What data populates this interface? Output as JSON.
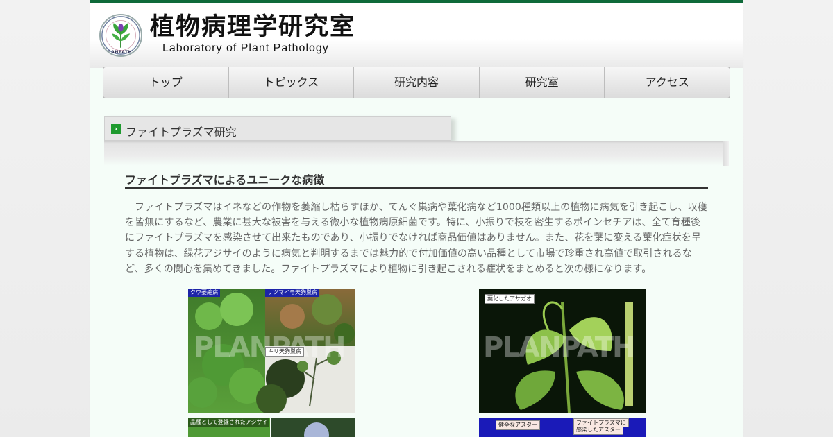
{
  "site": {
    "title": "植物病理学研究室",
    "subtitle": "Laboratory of Plant Pathology",
    "logo_text": "PLANPATH"
  },
  "nav": {
    "items": [
      {
        "label": "トップ"
      },
      {
        "label": "トピックス"
      },
      {
        "label": "研究内容"
      },
      {
        "label": "研究室"
      },
      {
        "label": "アクセス"
      }
    ]
  },
  "section": {
    "heading": "ファイトプラズマ研究",
    "icon": "chevron-right-icon"
  },
  "article": {
    "title": "ファイトプラズマによるユニークな病徴",
    "body": "ファイトプラズマはイネなどの作物を萎縮し枯らすほか、てんぐ巣病や葉化病など1000種類以上の植物に病気を引き起こし、収穫を皆無にするなど、農業に甚大な被害を与える微小な植物病原細菌です。特に、小振りで枝を密生するポインセチアは、全て育種後にファイトプラズマを感染させて出来たものであり、小振りでなければ商品価値はありません。また、花を葉に変える葉化症状を呈する植物は、緑花アジサイのように病気と判明するまでは魅力的で付加価値の高い品種として市場で珍重され高値で取引されるなど、多くの関心を集めてきました。ファイトプラズマにより植物に引き起こされる症状をまとめると次の様になります。"
  },
  "photos": {
    "left_top": {
      "label_1": "クワ萎縮病",
      "label_2": "サツマイモ天狗巣病",
      "label_3": "キリ天狗巣病",
      "watermark": "PLANPATH"
    },
    "left_bottom": {
      "label": "品種として登録されたアジサイ"
    },
    "right_top": {
      "label": "葉化したアサガオ",
      "watermark": "PLANPATH"
    },
    "right_bottom": {
      "label_1": "健全なアスター",
      "label_2a": "ファイトプラズマに",
      "label_2b": "感染したアスター"
    }
  },
  "colors": {
    "accent_green": "#0f6a3a",
    "icon_green": "#1e9a2e",
    "tag_blue": "#1d24a8"
  }
}
